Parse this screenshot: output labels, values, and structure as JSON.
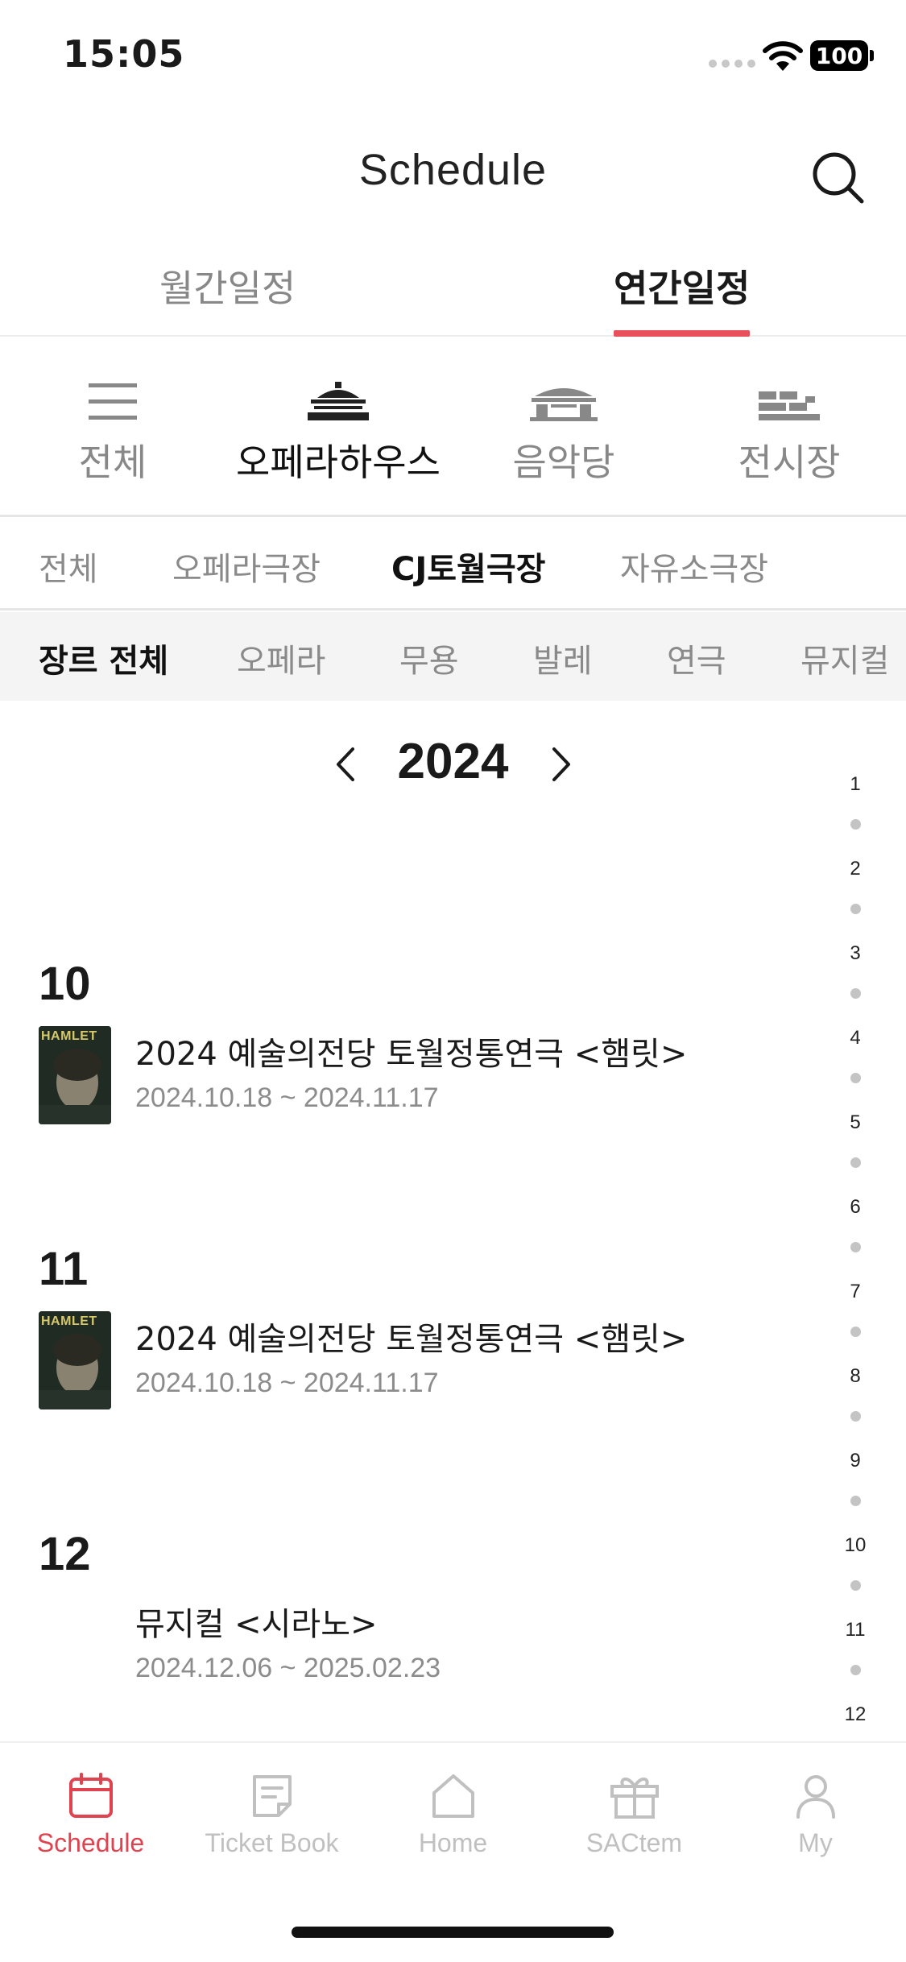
{
  "status_bar": {
    "time": "15:05",
    "battery": "100"
  },
  "header": {
    "title": "Schedule"
  },
  "top_tabs": [
    {
      "label": "월간일정",
      "active": false
    },
    {
      "label": "연간일정",
      "active": true
    }
  ],
  "venues": [
    {
      "label": "전체",
      "icon": "menu-icon",
      "active": false
    },
    {
      "label": "오페라하우스",
      "icon": "opera-house-icon",
      "active": true
    },
    {
      "label": "음악당",
      "icon": "concert-hall-icon",
      "active": false
    },
    {
      "label": "전시장",
      "icon": "exhibition-hall-icon",
      "active": false
    }
  ],
  "sub_venues": [
    {
      "label": "전체",
      "active": false
    },
    {
      "label": "오페라극장",
      "active": false
    },
    {
      "label": "CJ토월극장",
      "active": true
    },
    {
      "label": "자유소극장",
      "active": false
    }
  ],
  "genres": [
    {
      "label": "장르 전체",
      "active": true
    },
    {
      "label": "오페라",
      "active": false
    },
    {
      "label": "무용",
      "active": false
    },
    {
      "label": "발레",
      "active": false
    },
    {
      "label": "연극",
      "active": false
    },
    {
      "label": "뮤지컬",
      "active": false
    }
  ],
  "year": "2024",
  "month_index": [
    "1",
    "2",
    "3",
    "4",
    "5",
    "6",
    "7",
    "8",
    "9",
    "10",
    "11",
    "12"
  ],
  "months": [
    {
      "label": "10",
      "event": {
        "title": "2024 예술의전당 토월정통연극 <햄릿>",
        "date": "2024.10.18 ~ 2024.11.17",
        "thumb_text": "HAMLET"
      }
    },
    {
      "label": "11",
      "event": {
        "title": "2024 예술의전당 토월정통연극 <햄릿>",
        "date": "2024.10.18 ~ 2024.11.17",
        "thumb_text": "HAMLET"
      }
    },
    {
      "label": "12",
      "event": {
        "title": "뮤지컬 <시라노>",
        "date": "2024.12.06 ~ 2025.02.23",
        "thumb_text": ""
      }
    }
  ],
  "bottom_nav": [
    {
      "label": "Schedule",
      "icon": "calendar-icon",
      "active": true
    },
    {
      "label": "Ticket Book",
      "icon": "ticket-book-icon",
      "active": false
    },
    {
      "label": "Home",
      "icon": "home-icon",
      "active": false
    },
    {
      "label": "SACtem",
      "icon": "gift-icon",
      "active": false
    },
    {
      "label": "My",
      "icon": "person-icon",
      "active": false
    }
  ],
  "colors": {
    "accent": "#e0434f",
    "inactive": "#8a8a8a",
    "genre_bg": "#f4f4f4"
  }
}
